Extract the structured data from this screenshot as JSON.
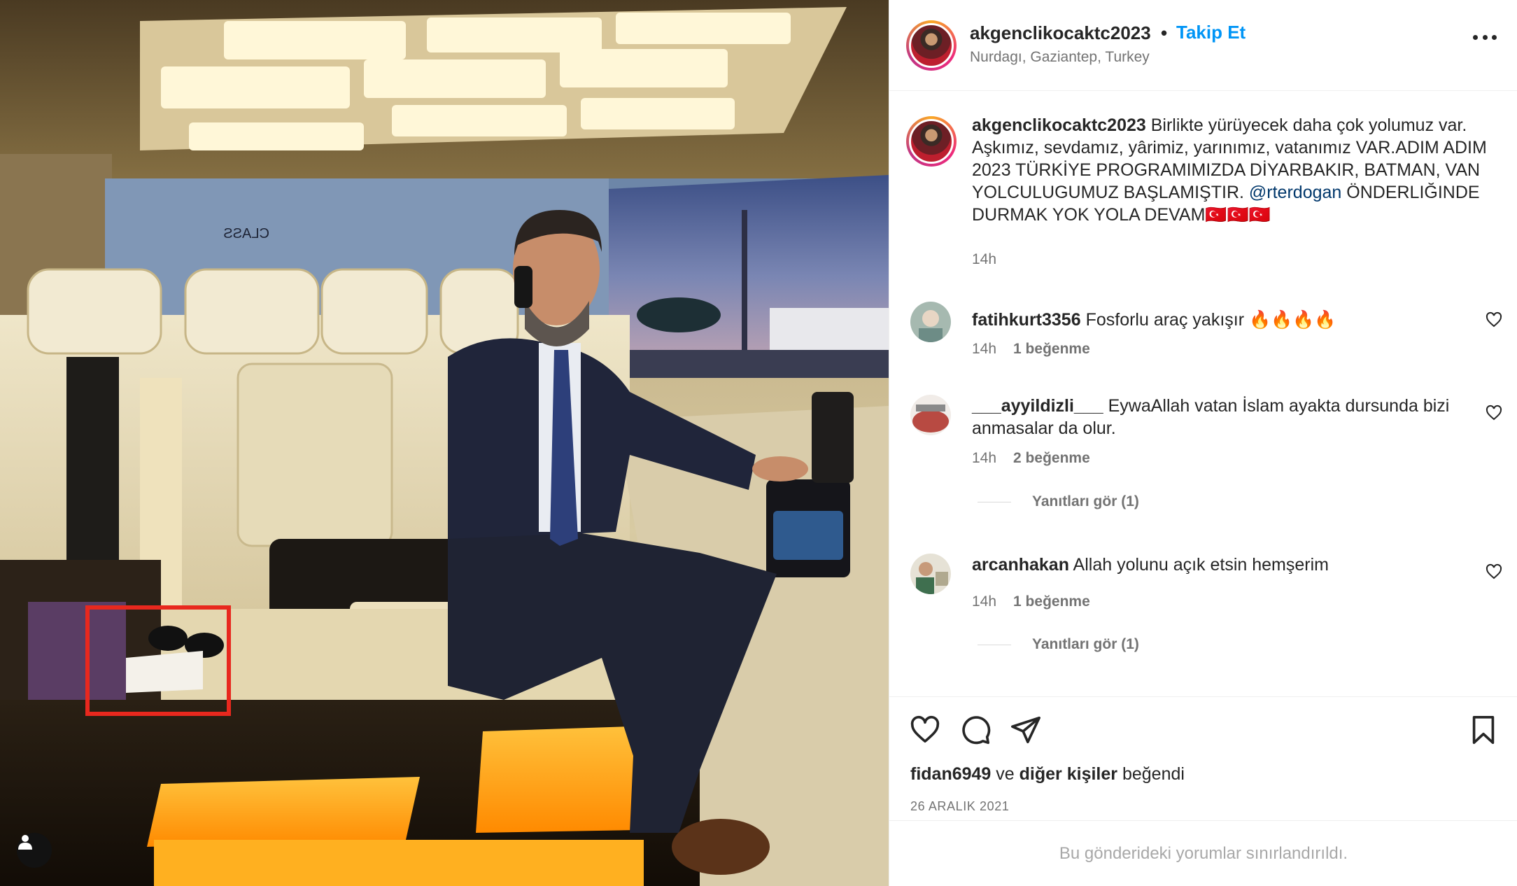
{
  "post": {
    "username": "akgenclikocaktc2023",
    "separator": "•",
    "follow_label": "Takip Et",
    "location": "Nurdagı, Gaziantep, Turkey",
    "more_icon": "more-options-icon"
  },
  "caption": {
    "username": "akgenclikocaktc2023",
    "text_part1": "Birlikte yürüyecek daha çok yolumuz var. Aşkımız, sevdamız, yârimiz, yarınımız, vatanımız VAR.ADIM ADIM 2023 TÜRKİYE PROGRAMIMIZDA DİYARBAKIR, BATMAN, VAN YOLCULUGUMUZ BAŞLAMIŞTIR.",
    "mention": "@rterdogan",
    "text_part2": "ÖNDERLIĞINDE DURMAK YOK YOLA DEVAM🇹🇷🇹🇷🇹🇷",
    "time": "14h"
  },
  "comments": [
    {
      "username": "fatihkurt3356",
      "text": "Fosforlu araç yakışır 🔥🔥🔥🔥",
      "time": "14h",
      "likes": "1 beğenme",
      "replies": ""
    },
    {
      "username": "___ayyildizli___",
      "text": "EywaAllah vatan İslam ayakta dursunda bizi anmasalar da olur.",
      "time": "14h",
      "likes": "2 beğenme",
      "replies": "Yanıtları gör (1)"
    },
    {
      "username": "arcanhakan",
      "text": "Allah yolunu açık etsin hemşerim",
      "time": "14h",
      "likes": "1 beğenme",
      "replies": "Yanıtları gör (1)"
    }
  ],
  "footer": {
    "liked_user": "fidan6949",
    "liked_connector": "ve",
    "liked_others": "diğer kişiler",
    "liked_suffix": "beğendi",
    "date": "26 ARALIK 2021",
    "restricted_notice": "Bu gönderideki yorumlar sınırlandırıldı."
  },
  "photo": {
    "sign_text": "CLASS",
    "highlight_color": "#e8281e"
  }
}
